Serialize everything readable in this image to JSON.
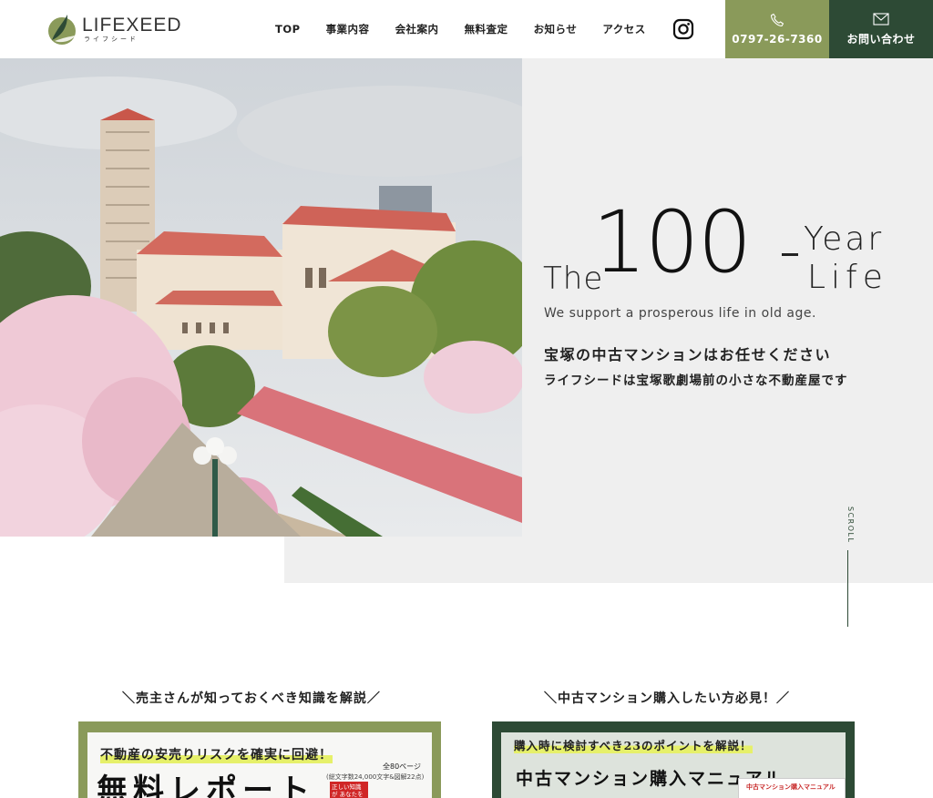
{
  "header": {
    "logo": {
      "name": "LIFEXEED",
      "kana": "ライフシード"
    },
    "nav": [
      "TOP",
      "事業内容",
      "会社案内",
      "無料査定",
      "お知らせ",
      "アクセス"
    ],
    "tel": {
      "label": "0797-26-7360"
    },
    "contact": {
      "label": "お問い合わせ"
    }
  },
  "hero": {
    "tagline": {
      "the": "The",
      "num": "100",
      "year": "Year",
      "life": "Life"
    },
    "subtitle": "We support a prosperous life in old age.",
    "jp_line1": "宝塚の中古マンションはお任せください",
    "jp_line2": "ライフシードは宝塚歌劇場前の小さな不動産屋です",
    "scroll": "SCROLL"
  },
  "sections": {
    "left_title": "＼売主さんが知っておくべき知識を解説／",
    "right_title": "＼中古マンション購入したい方必見！／"
  },
  "banner_left": {
    "head": "不動産の安売りリスクを確実に回避！",
    "big": "無料レポート",
    "pages": "全80ページ",
    "pages_sub": "(総文字数24,000文字&図解22点)",
    "badge": "正しい知識が あなたを"
  },
  "banner_right": {
    "head": "購入時に検討すべき23のポイントを解説！",
    "big": "中古マンション購入マニュアル",
    "card": "中古マンション購入マニュアル"
  },
  "colors": {
    "olive": "#8a9a5a",
    "dark_green": "#2d4a35",
    "hero_bg": "#efefef",
    "highlight": "#e6f06a"
  }
}
